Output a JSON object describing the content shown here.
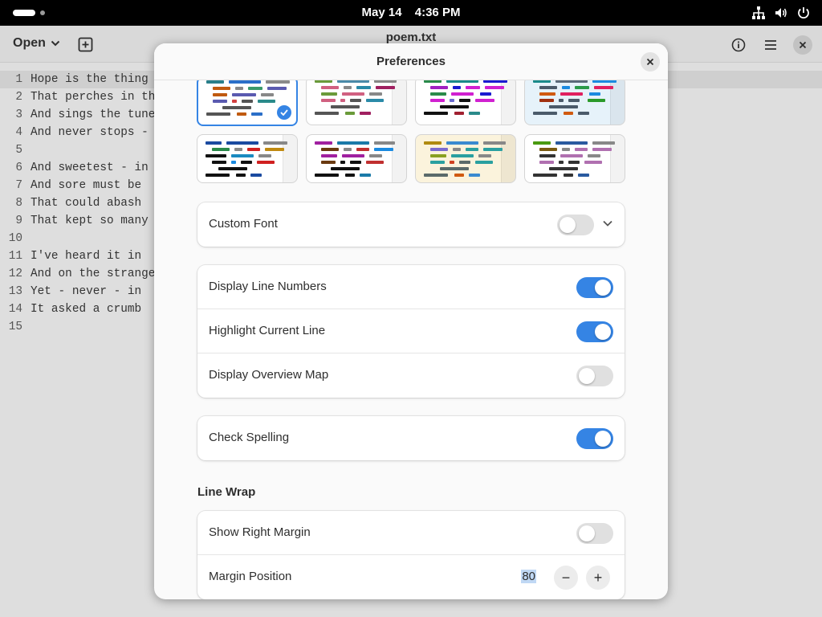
{
  "topbar": {
    "date": "May 14",
    "time": "4:36 PM",
    "icons": [
      "activities-pill",
      "workspace-dot",
      "network-icon",
      "volume-icon",
      "power-icon"
    ]
  },
  "editor": {
    "open_label": "Open",
    "title": "poem.txt",
    "lines": [
      {
        "n": "1",
        "text": "Hope is the thing"
      },
      {
        "n": "2",
        "text": "That perches in th"
      },
      {
        "n": "3",
        "text": "And sings the tune"
      },
      {
        "n": "4",
        "text": "And never stops -"
      },
      {
        "n": "5",
        "text": ""
      },
      {
        "n": "6",
        "text": "And sweetest - in"
      },
      {
        "n": "7",
        "text": "And sore must be"
      },
      {
        "n": "8",
        "text": "That could abash"
      },
      {
        "n": "9",
        "text": "That kept so many"
      },
      {
        "n": "10",
        "text": ""
      },
      {
        "n": "11",
        "text": "I've heard it in"
      },
      {
        "n": "12",
        "text": "And on the strange"
      },
      {
        "n": "13",
        "text": "Yet - never - in"
      },
      {
        "n": "14",
        "text": "It asked a crumb"
      },
      {
        "n": "15",
        "text": ""
      }
    ]
  },
  "preferences": {
    "title": "Preferences",
    "custom_font": {
      "label": "Custom Font",
      "enabled": false
    },
    "display_line_numbers": {
      "label": "Display Line Numbers",
      "enabled": true
    },
    "highlight_current_line": {
      "label": "Highlight Current Line",
      "enabled": true
    },
    "display_overview_map": {
      "label": "Display Overview Map",
      "enabled": false
    },
    "check_spelling": {
      "label": "Check Spelling",
      "enabled": true
    },
    "line_wrap_title": "Line Wrap",
    "show_right_margin": {
      "label": "Show Right Margin",
      "enabled": false
    },
    "margin_position": {
      "label": "Margin Position",
      "value": "80",
      "minus": "−",
      "plus": "+"
    }
  },
  "colors": {
    "accent": "#3584e4",
    "switch_off": "#e0e0e0"
  }
}
